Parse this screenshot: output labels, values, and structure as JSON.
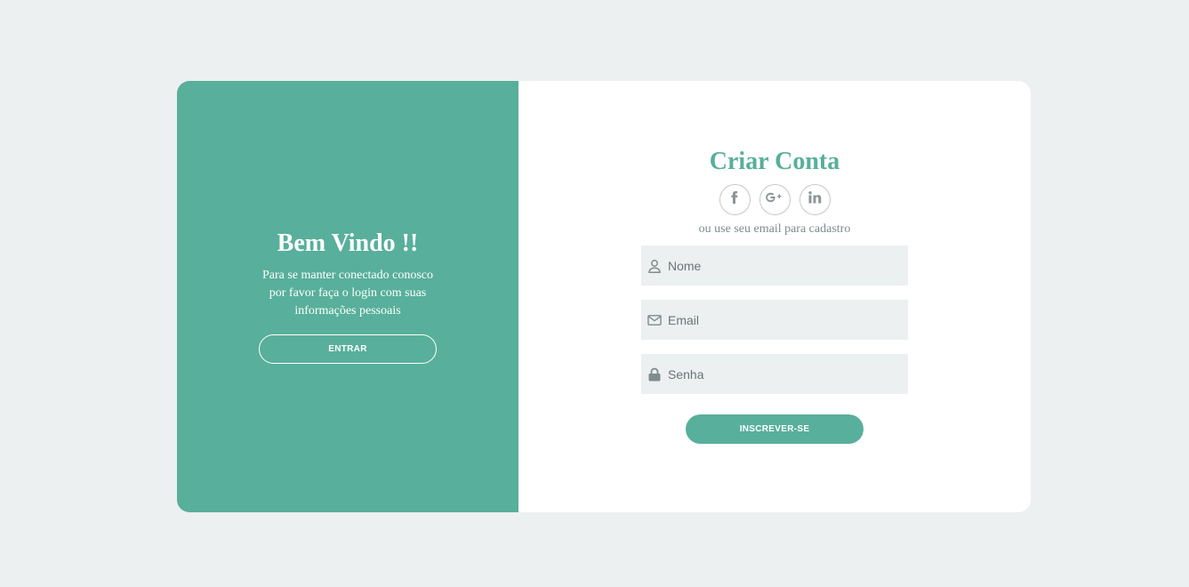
{
  "colors": {
    "accent": "#58af9b",
    "background": "#ecf0f1",
    "muted": "#7f8c8d"
  },
  "welcome": {
    "title": "Bem Vindo !!",
    "description": "Para se manter conectado conosco por favor faça o login com suas informações pessoais",
    "button_label": "ENTRAR"
  },
  "signup": {
    "title": "Criar Conta",
    "social": [
      "facebook-icon",
      "google-plus-icon",
      "linkedin-icon"
    ],
    "subtitle": "ou use seu email para cadastro",
    "fields": {
      "name": {
        "placeholder": "Nome",
        "icon": "user-icon"
      },
      "email": {
        "placeholder": "Email",
        "icon": "envelope-icon"
      },
      "password": {
        "placeholder": "Senha",
        "icon": "lock-icon"
      }
    },
    "button_label": "INSCREVER-SE"
  }
}
